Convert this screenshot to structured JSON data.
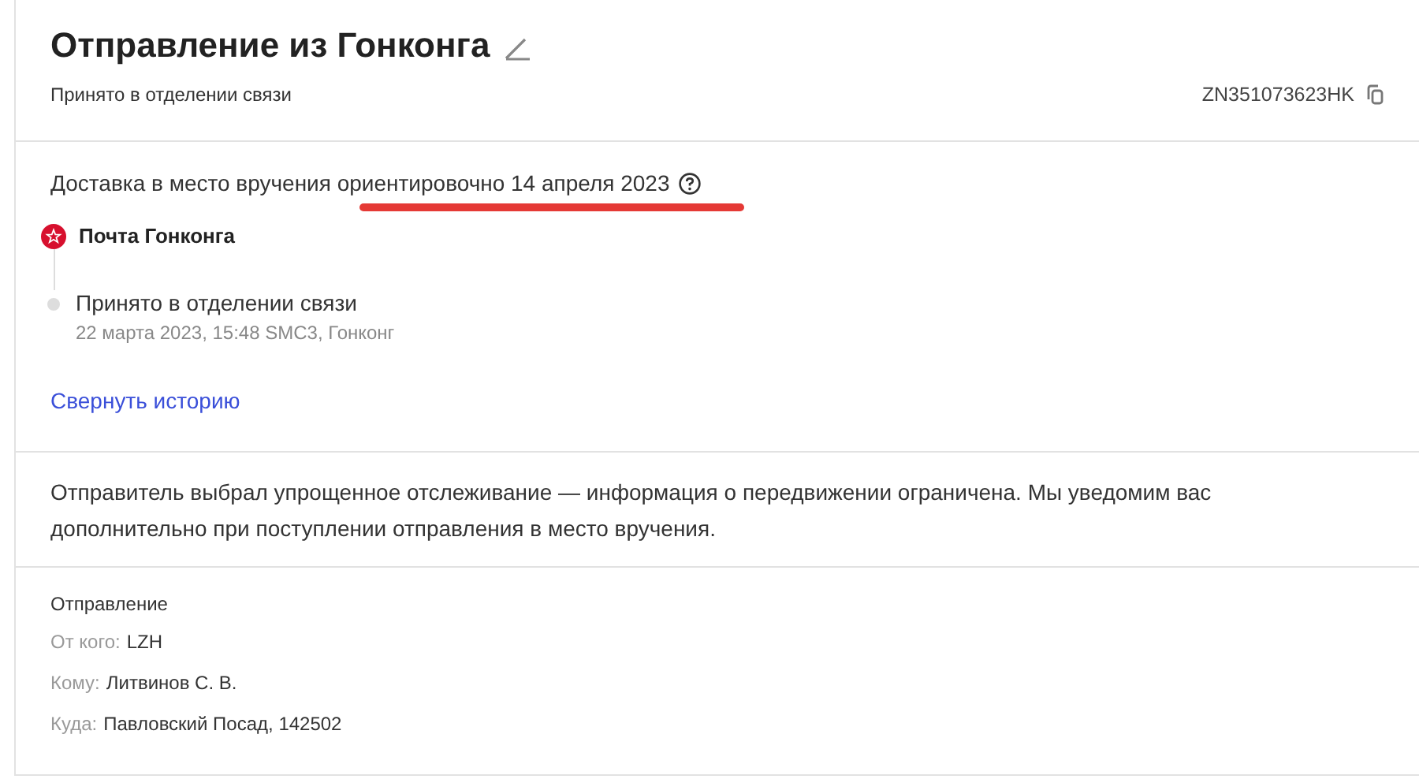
{
  "header": {
    "title": "Отправление из Гонконга",
    "status": "Принято в отделении связи",
    "tracking_number": "ZN351073623HK"
  },
  "delivery": {
    "text": "Доставка в место вручения ориентировочно 14 апреля 2023"
  },
  "history": [
    {
      "kind": "operator",
      "label": "Почта Гонконга"
    },
    {
      "kind": "event",
      "label": "Принято в отделении связи",
      "details": "22 марта 2023, 15:48 SMC3, Гонконг"
    }
  ],
  "collapse_link": "Свернуть историю",
  "notice": "Отправитель выбрал упрощенное отслеживание — информация о передвижении ограничена. Мы уведомим вас дополнительно при поступлении отправления в место вручения.",
  "shipment": {
    "heading": "Отправление",
    "rows": [
      {
        "label": "От кого:",
        "value": "LZH"
      },
      {
        "label": "Кому:",
        "value": "Литвинов С. В."
      },
      {
        "label": "Куда:",
        "value": "Павловский Посад, 142502"
      }
    ]
  }
}
